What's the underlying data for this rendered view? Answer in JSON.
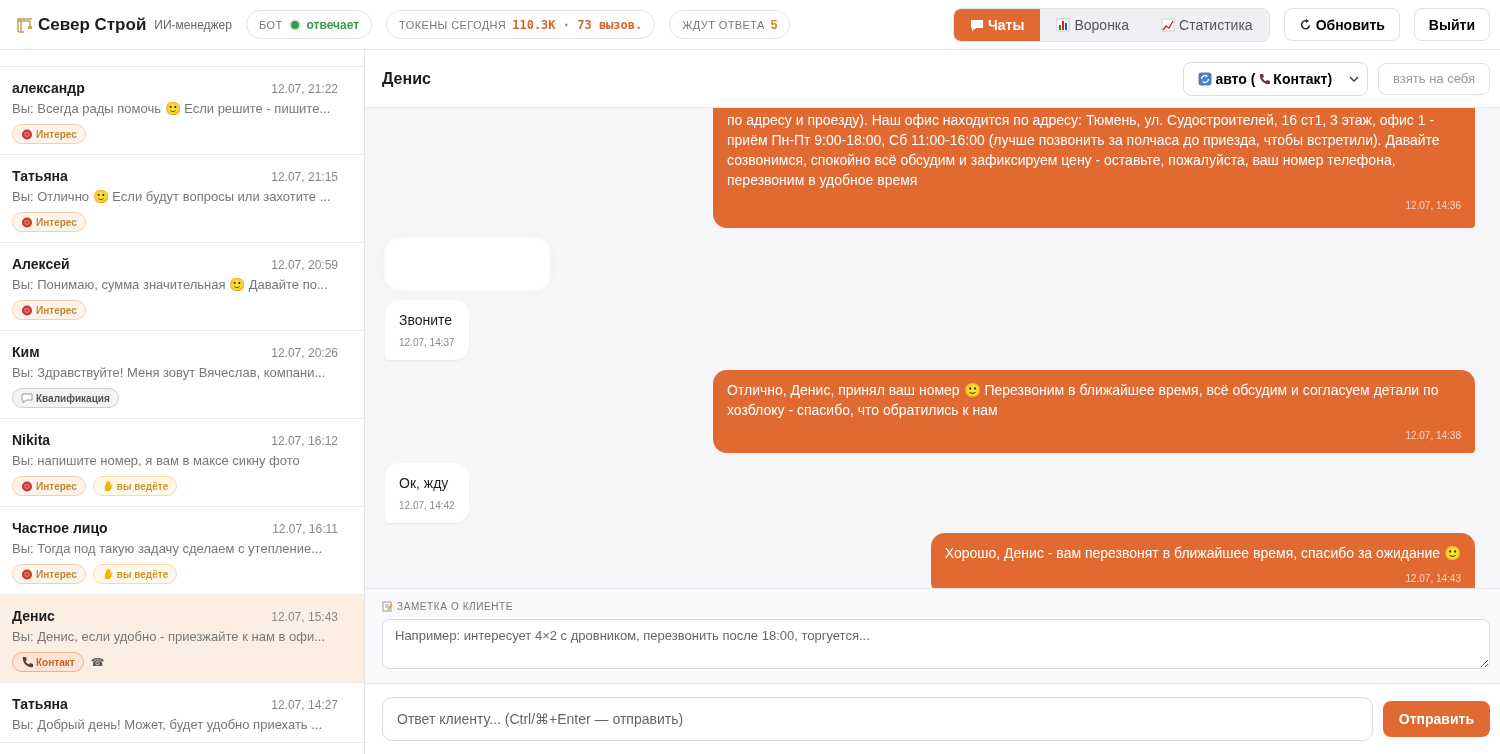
{
  "header": {
    "brand": "Север Строй",
    "subtitle": "ИИ-менеджер",
    "stats": [
      {
        "kind": "bot",
        "label": "БОТ",
        "value": "отвечает",
        "on": true
      },
      {
        "kind": "tokens",
        "label": "ТОКЕНЫ СЕГОДНЯ",
        "value": "110.3K · 73 вызов."
      },
      {
        "kind": "waiting",
        "label": "ЖДУТ ОТВЕТА",
        "value": "5"
      }
    ],
    "tabs": [
      {
        "kind": "chats",
        "label": "Чаты",
        "selected": true
      },
      {
        "kind": "funnel",
        "label": "Воронка",
        "selected": false
      },
      {
        "kind": "stats",
        "label": "Статистика",
        "selected": false
      }
    ],
    "buttons": [
      {
        "kind": "refresh",
        "label": "Обновить"
      },
      {
        "kind": "logout",
        "label": "Выйти"
      }
    ]
  },
  "sidebar": {
    "chats": [
      {
        "name": "александр",
        "time": "12.07, 21:22",
        "preview": "Вы: Всегда рады помочь 🙂 Если решите - пишите...",
        "selected": false,
        "tags": [
          {
            "kind": "interest",
            "label": "Интерес"
          }
        ]
      },
      {
        "name": "Татьяна",
        "time": "12.07, 21:15",
        "preview": "Вы: Отлично 🙂 Если будут вопросы или захотите ...",
        "selected": false,
        "tags": [
          {
            "kind": "interest",
            "label": "Интерес"
          }
        ]
      },
      {
        "name": "Алексей",
        "time": "12.07, 20:59",
        "preview": "Вы: Понимаю, сумма значительная 🙂 Давайте по...",
        "selected": false,
        "tags": [
          {
            "kind": "interest",
            "label": "Интерес"
          }
        ]
      },
      {
        "name": "Ким",
        "time": "12.07, 20:26",
        "preview": "Вы: Здравствуйте! Меня зовут Вячеслав, компани...",
        "selected": false,
        "tags": [
          {
            "kind": "qualification",
            "label": "Квалификация"
          }
        ]
      },
      {
        "name": "Nikita",
        "time": "12.07, 16:12",
        "preview": "Вы: напишите номер, я вам в максе сикну фото",
        "selected": false,
        "tags": [
          {
            "kind": "interest",
            "label": "Интерес"
          },
          {
            "kind": "manual",
            "label": "вы ведёте"
          }
        ]
      },
      {
        "name": "Частное лицо",
        "time": "12.07, 16:11",
        "preview": "Вы: Тогда под такую задачу сделаем с утепление...",
        "selected": false,
        "tags": [
          {
            "kind": "interest",
            "label": "Интерес"
          },
          {
            "kind": "manual",
            "label": "вы ведёте"
          }
        ]
      },
      {
        "name": "Денис",
        "time": "12.07, 15:43",
        "preview": "Вы: Денис, если удобно - приезжайте к нам в офи...",
        "selected": true,
        "tags": [
          {
            "kind": "contact",
            "label": "Контакт"
          }
        ],
        "mark": "☎"
      },
      {
        "name": "Татьяна",
        "time": "12.07, 14:27",
        "preview": "Вы: Добрый день! Может, будет удобно приехать ...",
        "selected": false
      }
    ]
  },
  "chat": {
    "title": "Денис",
    "mode_select": {
      "prefix": "авто (",
      "label": "Контакт)"
    },
    "take_over": {
      "label": "взять на себя",
      "disabled": true
    },
    "messages": [
      {
        "kind": "out",
        "text": "по адресу и проезду). Наш офис находится по адресу: Тюмень, ул. Судостроителей, 16 ст1, 3 этаж, офис 1 - приём Пн-Пт 9:00-18:00, Сб 11:00-16:00 (лучше позвонить за полчаса до приезда, чтобы встретили). Давайте созвонимся, спокойно всё обсудим и зафиксируем цену - оставьте, пожалуйста, ваш номер телефона, перезвоним в удобное время",
        "time": "12.07, 14:36"
      },
      {
        "kind": "blurred"
      },
      {
        "kind": "in",
        "text": "Звоните",
        "time": "12.07, 14:37"
      },
      {
        "kind": "out",
        "text": "Отлично, Денис, принял ваш номер 🙂 Перезвоним в ближайшее время, всё обсудим и согласуем детали по хозблоку - спасибо, что обратились к нам",
        "time": "12.07, 14:38"
      },
      {
        "kind": "in",
        "text": "Ок, жду",
        "time": "12.07, 14:42"
      },
      {
        "kind": "out",
        "text": "Хорошо, Денис - вам перезвонят в ближайшее время, спасибо за ожидание 🙂",
        "time": "12.07, 14:43"
      }
    ],
    "note": {
      "label": "ЗАМЕТКА О КЛИЕНТЕ",
      "placeholder": "Например: интересует 4×2 с дровником, перезвонить после 18:00, торгуется..."
    },
    "reply": {
      "placeholder": "Ответ клиенту... (Ctrl/⌘+Enter — отправить)",
      "send": "Отправить"
    }
  }
}
